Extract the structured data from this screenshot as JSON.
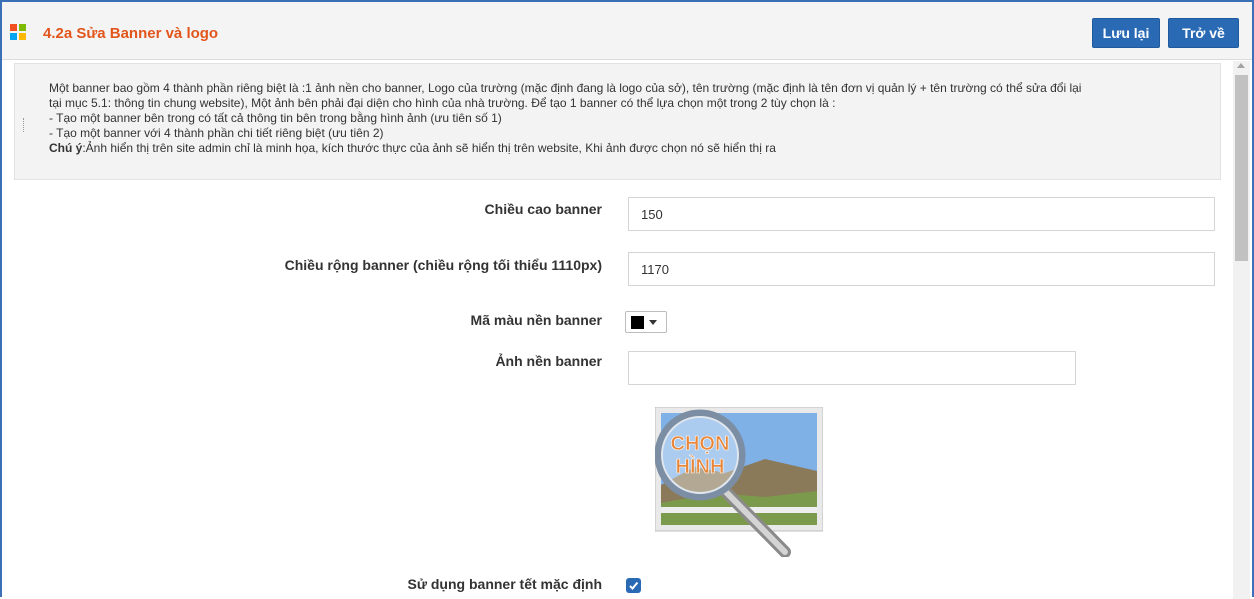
{
  "header": {
    "title": "4.2a Sửa Banner và logo",
    "save_label": "Lưu lại",
    "back_label": "Trở về",
    "accent_color": "#e2551b",
    "button_color": "#2a6ab5"
  },
  "notice": {
    "line1": "Một banner bao gồm 4 thành phần riêng biệt là :1 ảnh nền cho banner, Logo của trường (mặc định đang là logo của sở), tên trường (mặc định là tên đơn vị quản lý + tên trường có thể sửa đổi lại",
    "line2": "tại mục 5.1: thông tin chung website), Một ảnh bên phải đại diện cho hình của nhà trường. Để tạo 1 banner có thể lựa chọn một trong 2 tùy chọn là :",
    "line3": "- Tạo một banner bên trong có tất cả thông tin bên trong bằng hình ảnh (ưu tiên số 1)",
    "line4": "- Tạo một banner với 4 thành phần chi tiết riêng biệt (ưu tiên 2)",
    "note_label": "Chú ý",
    "note_text": ":Ảnh hiển thị trên site admin chỉ là minh họa, kích thước thực của ảnh sẽ hiển thị trên website, Khi ảnh được chọn nó sẽ hiển thị ra"
  },
  "form": {
    "height_label": "Chiều cao banner",
    "height_value": "150",
    "width_label": "Chiều rộng banner (chiều rộng tối thiểu 1110px)",
    "width_value": "1170",
    "bgcolor_label": "Mã màu nền banner",
    "bgcolor_value": "#000000",
    "bgimage_label": "Ảnh nền banner",
    "bgimage_value": "",
    "chooser_text_line1": "CHỌN",
    "chooser_text_line2": "HÌNH",
    "default_tet_label": "Sử dụng banner tết mặc định",
    "default_tet_checked": true
  }
}
